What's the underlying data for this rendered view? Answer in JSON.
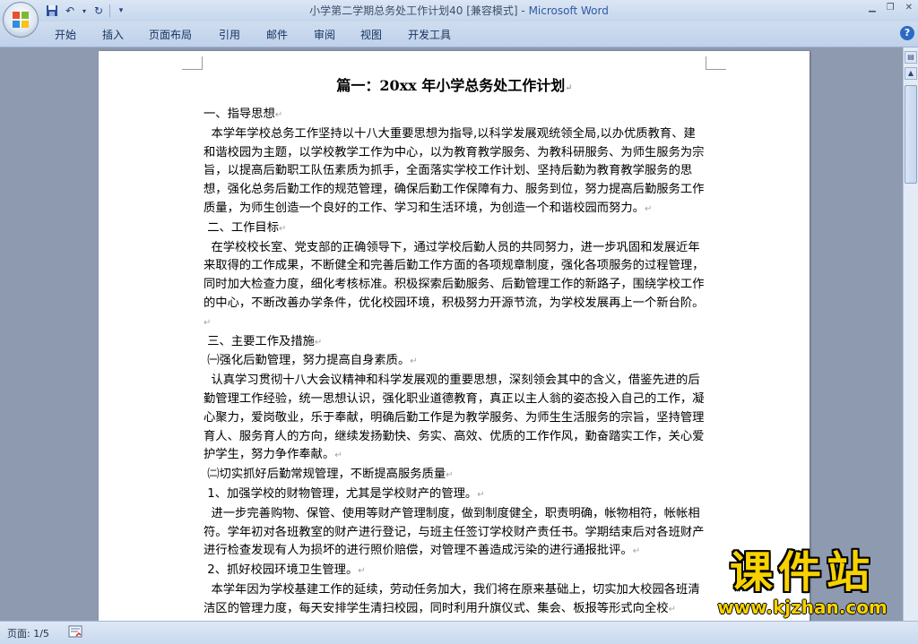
{
  "window": {
    "title_doc": "小学第二学期总务处工作计划40 [兼容模式] - ",
    "title_app": "Microsoft Word"
  },
  "ribbon": {
    "tabs": [
      "开始",
      "插入",
      "页面布局",
      "引用",
      "邮件",
      "审阅",
      "视图",
      "开发工具"
    ]
  },
  "document": {
    "title": "篇一：20xx 年小学总务处工作计划",
    "paragraphs": [
      "一、指导思想",
      "  本学年学校总务工作坚持以十八大重要思想为指导,以科学发展观统领全局,以办优质教育、建和谐校园为主题，以学校教学工作为中心，以为教育教学服务、为教科研服务、为师生服务为宗旨，以提高后勤职工队伍素质为抓手，全面落实学校工作计划、坚持后勤为教育教学服务的思想，强化总务后勤工作的规范管理，确保后勤工作保障有力、服务到位，努力提高后勤服务工作质量，为师生创造一个良好的工作、学习和生活环境，为创造一个和谐校园而努力。",
      " 二、工作目标",
      "  在学校校长室、党支部的正确领导下，通过学校后勤人员的共同努力，进一步巩固和发展近年来取得的工作成果，不断健全和完善后勤工作方面的各项规章制度，强化各项服务的过程管理，同时加大检查力度，细化考核标准。积极探索后勤服务、后勤管理工作的新路子，围绕学校工作的中心，不断改善办学条件，优化校园环境，积极努力开源节流，为学校发展再上一个新台阶。",
      " 三、主要工作及措施",
      " ㈠强化后勤管理，努力提高自身素质。",
      "  认真学习贯彻十八大会议精神和科学发展观的重要思想，深刻领会其中的含义，借鉴先进的后勤管理工作经验，统一思想认识，强化职业道德教育，真正以主人翁的姿态投入自己的工作，凝心聚力，爱岗敬业，乐于奉献，明确后勤工作是为教学服务、为师生生活服务的宗旨，坚持管理育人、服务育人的方向，继续发扬勤快、务实、高效、优质的工作作风，勤奋踏实工作，关心爱护学生，努力争作奉献。",
      " ㈡切实抓好后勤常规管理，不断提高服务质量",
      " 1、加强学校的财物管理，尤其是学校财产的管理。",
      "  进一步完善购物、保管、使用等财产管理制度，做到制度健全，职责明确，帐物相符，帐帐相符。学年初对各班教室的财产进行登记，与班主任签订学校财产责任书。学期结束后对各班财产进行检查发现有人为损坏的进行照价赔偿，对管理不善造成污染的进行通报批评。",
      " 2、抓好校园环境卫生管理。",
      "  本学年因为学校基建工作的延续，劳动任务加大，我们将在原来基础上，切实加大校园各班清洁区的管理力度，每天安排学生清扫校园，同时利用升旗仪式、集会、板报等形式向全校"
    ]
  },
  "statusbar": {
    "page": "页面: 1/5"
  },
  "watermark": {
    "top": "课件站",
    "bottom": "www.kjzhan.com"
  },
  "icons": [
    "office-button-icon",
    "save-icon",
    "undo-icon",
    "redo-icon",
    "customize-qat-icon",
    "minimize-icon",
    "restore-icon",
    "close-icon",
    "help-icon",
    "spell-check-icon"
  ]
}
